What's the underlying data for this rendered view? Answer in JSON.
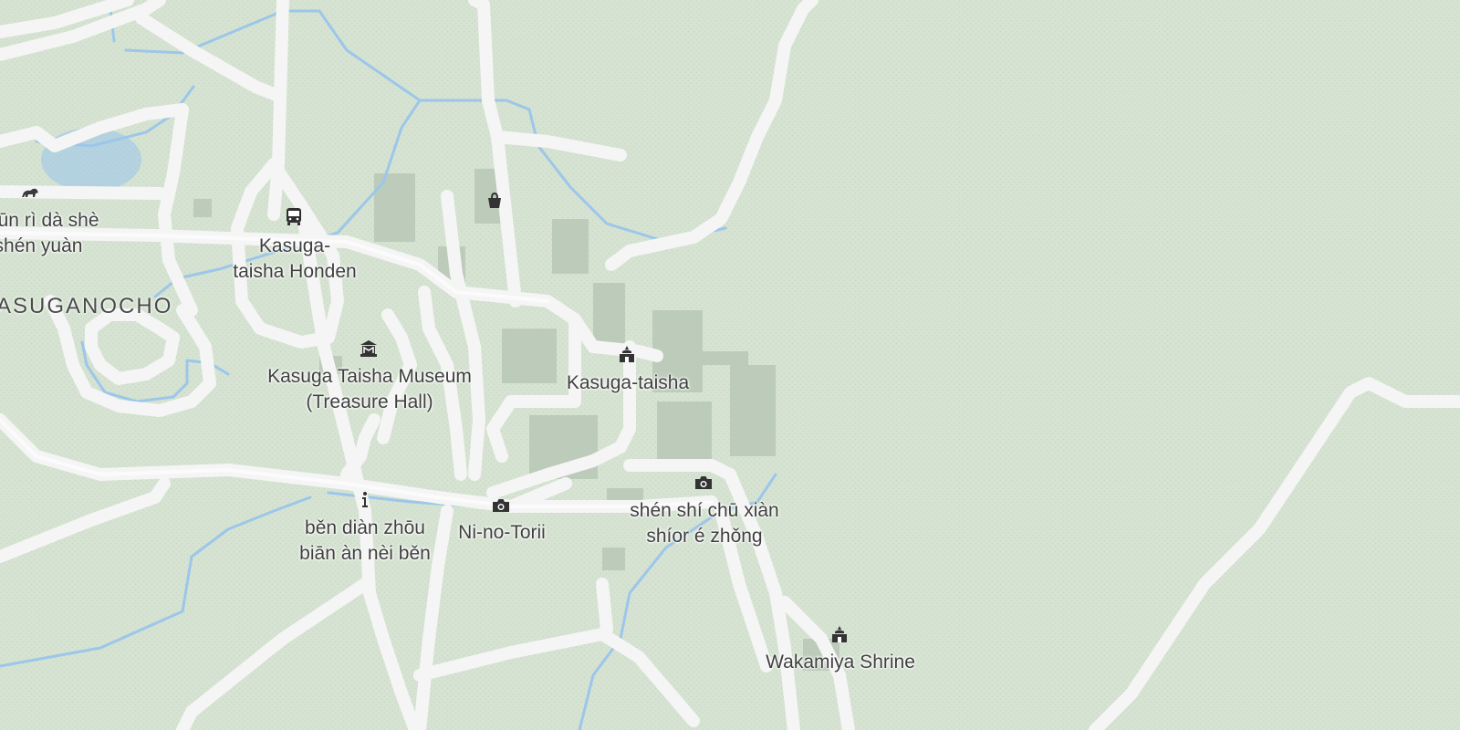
{
  "map": {
    "area_label": "KASUGANOCHO",
    "places": {
      "zoo": {
        "line1": "chūn rì dà shè",
        "line2": "shén yuàn"
      },
      "honden": {
        "line1": "Kasuga-",
        "line2": "taisha Honden"
      },
      "museum": {
        "line1": "Kasuga Taisha Museum",
        "line2": "(Treasure Hall)"
      },
      "shrine": {
        "line1": "Kasuga-taisha"
      },
      "info": {
        "line1": "běn diàn zhōu",
        "line2": "biān àn nèi běn"
      },
      "torii": {
        "line1": "Ni-no-Torii"
      },
      "deer": {
        "line1": "shén shí chū xiàn",
        "line2": "shíor é zhǒng"
      },
      "wakamiya": {
        "line1": "Wakamiya Shrine"
      }
    },
    "icons": [
      "zoo-icon",
      "bus-icon",
      "museum-icon",
      "shopping-bag-icon",
      "shrine-icon",
      "info-icon",
      "camera-icon",
      "camera-icon",
      "shrine-icon"
    ],
    "colors": {
      "land": "#d6e3d2",
      "road": "#f5f5f5",
      "water": "#9cc6ea",
      "building": "#b9c8b6"
    }
  }
}
